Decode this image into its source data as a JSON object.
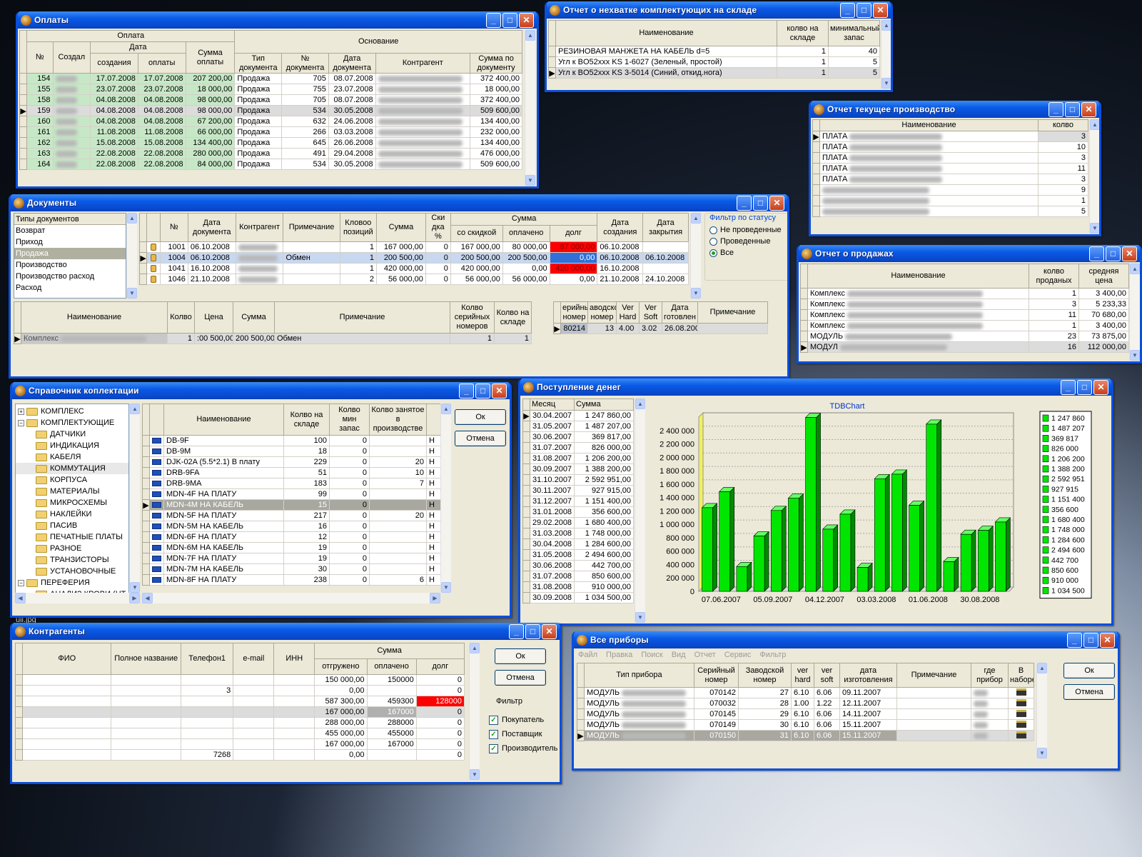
{
  "payments": {
    "title": "Оплаты",
    "grp_payment": "Оплата",
    "grp_basis": "Основание",
    "grp_date": "Дата",
    "cols": {
      "num": "№",
      "creator": "Создал",
      "created": "создания",
      "paid": "оплаты",
      "sum": "Сумма оплаты",
      "doctype": "Тип документа",
      "docnum": "№ документа",
      "docdate": "Дата документа",
      "contractor": "Контрагент",
      "docsum": "Сумма по документу"
    },
    "rows": [
      [
        "154",
        "17.07.2008",
        "17.07.2008",
        "207 200,00",
        "Продажа",
        "705",
        "08.07.2008",
        "372 400,00"
      ],
      [
        "155",
        "23.07.2008",
        "23.07.2008",
        "18 000,00",
        "Продажа",
        "755",
        "23.07.2008",
        "18 000,00"
      ],
      [
        "158",
        "04.08.2008",
        "04.08.2008",
        "98 000,00",
        "Продажа",
        "705",
        "08.07.2008",
        "372 400,00"
      ],
      [
        "159",
        "04.08.2008",
        "04.08.2008",
        "98 000,00",
        "Продажа",
        "534",
        "30.05.2008",
        "509 600,00"
      ],
      [
        "160",
        "04.08.2008",
        "04.08.2008",
        "67 200,00",
        "Продажа",
        "632",
        "24.06.2008",
        "134 400,00"
      ],
      [
        "161",
        "11.08.2008",
        "11.08.2008",
        "66 000,00",
        "Продажа",
        "266",
        "03.03.2008",
        "232 000,00"
      ],
      [
        "162",
        "15.08.2008",
        "15.08.2008",
        "134 400,00",
        "Продажа",
        "645",
        "26.06.2008",
        "134 400,00"
      ],
      [
        "163",
        "22.08.2008",
        "22.08.2008",
        "280 000,00",
        "Продажа",
        "491",
        "29.04.2008",
        "476 000,00"
      ],
      [
        "164",
        "22.08.2008",
        "22.08.2008",
        "84 000,00",
        "Продажа",
        "534",
        "30.05.2008",
        "509 600,00"
      ]
    ]
  },
  "shortage": {
    "title": "Отчет о нехватке комплектующих на складе",
    "cols": {
      "name": "Наименование",
      "qty": "колво на складе",
      "min": "минимальный запас"
    },
    "rows": [
      [
        "РЕЗИНОВАЯ МАНЖЕТА НА КАБЕЛЬ d=5",
        "1",
        "40"
      ],
      [
        "Угл к BO52xxx KS 1-6027 (Зеленый, простой)",
        "1",
        "5"
      ],
      [
        "Угл к BO52xxx KS 3-5014 (Синий, откид.нога)",
        "1",
        "5"
      ]
    ]
  },
  "production": {
    "title": "Отчет текущее производство",
    "cols": {
      "name": "Наименование",
      "qty": "колво"
    },
    "rows": [
      [
        "ПЛАТА",
        "3"
      ],
      [
        "ПЛАТА",
        "10"
      ],
      [
        "ПЛАТА",
        "3"
      ],
      [
        "ПЛАТА",
        "11"
      ],
      [
        "ПЛАТА",
        "3"
      ],
      [
        "",
        "9"
      ],
      [
        "",
        "1"
      ],
      [
        "",
        "5"
      ]
    ]
  },
  "sales": {
    "title": "Отчет о продажах",
    "cols": {
      "name": "Наименование",
      "sold": "колво проданых",
      "avg": "средняя цена"
    },
    "rows": [
      [
        "Комплекс",
        "1",
        "3 400,00"
      ],
      [
        "Комплекс",
        "3",
        "5 233,33"
      ],
      [
        "Комплекс",
        "11",
        "70 680,00"
      ],
      [
        "Комплекс",
        "1",
        "3 400,00"
      ],
      [
        "МОДУЛЬ",
        "23",
        "73 875,00"
      ],
      [
        "МОДУЛ",
        "16",
        "112 000,00"
      ]
    ]
  },
  "documents": {
    "title": "Документы",
    "types": [
      "Типы документов",
      "Возврат",
      "Приход",
      "Продажа",
      "Производство",
      "Производство расход",
      "Расход"
    ],
    "cols": {
      "num": "№",
      "date": "Дата документа",
      "contractor": "Контрагент",
      "note": "Примечание",
      "positions": "Кловоо позиций",
      "sum": "Сумма",
      "discount": "Ски дка %",
      "grp_sum": "Сумма",
      "withdisc": "со скидкой",
      "paid": "оплачено",
      "debt": "долг",
      "created": "Дата создания",
      "closed": "Дата закрытия"
    },
    "rows": [
      [
        "1001",
        "06.10.2008",
        "",
        "1",
        "167 000,00",
        "0",
        "167 000,00",
        "80 000,00",
        "87 000,00",
        "06.10.2008",
        ""
      ],
      [
        "1004",
        "06.10.2008",
        "Обмен",
        "1",
        "200 500,00",
        "0",
        "200 500,00",
        "200 500,00",
        "0,00",
        "06.10.2008",
        "06.10.2008"
      ],
      [
        "1041",
        "16.10.2008",
        "",
        "1",
        "420 000,00",
        "0",
        "420 000,00",
        "0,00",
        "420 000,00",
        "16.10.2008",
        ""
      ],
      [
        "1046",
        "21.10.2008",
        "",
        "2",
        "56 000,00",
        "0",
        "56 000,00",
        "56 000,00",
        "0,00",
        "21.10.2008",
        "24.10.2008"
      ]
    ],
    "filter": {
      "legend": "Фильтр по статусу",
      "opt1": "Не проведенные",
      "opt2": "Проведенные",
      "opt3": "Все"
    },
    "items_cols": {
      "name": "Наименование",
      "qty": "Колво",
      "price": "Цена",
      "sum": "Сумма",
      "note": "Примечание",
      "serials": "Колво серийных номеров",
      "stock": "Колво на складе"
    },
    "items_row": [
      "Комплекс",
      "1",
      ":00 500,00",
      "200 500,00",
      "Обмен",
      "1",
      "1"
    ],
    "ser_cols": {
      "serial": "ерийны номер",
      "factory": "аводско номер",
      "hard": "Ver Hard",
      "soft": "Ver Soft",
      "made": "Дата готовлен",
      "note": "Примечание"
    },
    "ser_row": [
      "80214",
      "13",
      "4.00",
      "3.02",
      "26.08.200",
      ""
    ]
  },
  "catalog": {
    "title": "Справочник коплектации",
    "tree": [
      {
        "t": "КОМПЛЕКС",
        "lvl": 0,
        "tog": "+"
      },
      {
        "t": "КОМПЛЕКТУЮЩИЕ",
        "lvl": 0,
        "tog": "−"
      },
      {
        "t": "ДАТЧИКИ",
        "lvl": 1
      },
      {
        "t": "ИНДИКАЦИЯ",
        "lvl": 1
      },
      {
        "t": "КАБЕЛЯ",
        "lvl": 1
      },
      {
        "t": "КОММУТАЦИЯ",
        "lvl": 1
      },
      {
        "t": "КОРПУСА",
        "lvl": 1
      },
      {
        "t": "МАТЕРИАЛЫ",
        "lvl": 1
      },
      {
        "t": "МИКРОСХЕМЫ",
        "lvl": 1
      },
      {
        "t": "НАКЛЕЙКИ",
        "lvl": 1
      },
      {
        "t": "ПАСИВ",
        "lvl": 1
      },
      {
        "t": "ПЕЧАТНЫЕ ПЛАТЫ",
        "lvl": 1
      },
      {
        "t": "РАЗНОЕ",
        "lvl": 1
      },
      {
        "t": "ТРАНЗИСТОРЫ",
        "lvl": 1
      },
      {
        "t": "УСТАНОВОЧНЫЕ",
        "lvl": 1
      },
      {
        "t": "ПЕРЕФЕРИЯ",
        "lvl": 0,
        "tog": "−"
      },
      {
        "t": "АНАЛИЗ КРОВИ (НТ",
        "lvl": 1
      }
    ],
    "cols": {
      "name": "Наименование",
      "stock": "Колво на складе",
      "min": "Колво мин запас",
      "busy": "Колво занятое в производстве"
    },
    "rows": [
      [
        "DB-9F",
        "100",
        "0",
        "",
        "Н"
      ],
      [
        "DB-9M",
        "18",
        "0",
        "",
        "Н"
      ],
      [
        "DJK-02A (5.5*2.1) В плату",
        "229",
        "0",
        "20",
        "Н"
      ],
      [
        "DRB-9FA",
        "51",
        "0",
        "10",
        "Н"
      ],
      [
        "DRB-9MA",
        "183",
        "0",
        "7",
        "Н"
      ],
      [
        "MDN-4F НА ПЛАТУ",
        "99",
        "0",
        "",
        "Н"
      ],
      [
        "MDN-4M НА КАБЕЛЬ",
        "15",
        "0",
        "",
        "Н"
      ],
      [
        "MDN-5F НА ПЛАТУ",
        "217",
        "0",
        "20",
        "Н"
      ],
      [
        "MDN-5M НА КАБЕЛЬ",
        "16",
        "0",
        "",
        "Н"
      ],
      [
        "MDN-6F НА ПЛАТУ",
        "12",
        "0",
        "",
        "Н"
      ],
      [
        "MDN-6M НА КАБЕЛЬ",
        "19",
        "0",
        "",
        "Н"
      ],
      [
        "MDN-7F НА ПЛАТУ",
        "19",
        "0",
        "",
        "Н"
      ],
      [
        "MDN-7M НА КАБЕЛЬ",
        "30",
        "0",
        "",
        "Н"
      ],
      [
        "MDN-8F НА ПЛАТУ",
        "238",
        "0",
        "6",
        "Н"
      ]
    ],
    "ok": "Ок",
    "cancel": "Отмена"
  },
  "money": {
    "title": "Поступление денег",
    "cols": {
      "month": "Месяц",
      "sum": "Сумма"
    },
    "rows": [
      [
        "30.04.2007",
        "1 247 860,00"
      ],
      [
        "31.05.2007",
        "1 487 207,00"
      ],
      [
        "30.06.2007",
        "369 817,00"
      ],
      [
        "31.07.2007",
        "826 000,00"
      ],
      [
        "31.08.2007",
        "1 206 200,00"
      ],
      [
        "30.09.2007",
        "1 388 200,00"
      ],
      [
        "31.10.2007",
        "2 592 951,00"
      ],
      [
        "30.11.2007",
        "927 915,00"
      ],
      [
        "31.12.2007",
        "1 151 400,00"
      ],
      [
        "31.01.2008",
        "356 600,00"
      ],
      [
        "29.02.2008",
        "1 680 400,00"
      ],
      [
        "31.03.2008",
        "1 748 000,00"
      ],
      [
        "30.04.2008",
        "1 284 600,00"
      ],
      [
        "31.05.2008",
        "2 494 600,00"
      ],
      [
        "30.06.2008",
        "442 700,00"
      ],
      [
        "31.07.2008",
        "850 600,00"
      ],
      [
        "31.08.2008",
        "910 000,00"
      ],
      [
        "30.09.2008",
        "1 034 500,00"
      ]
    ]
  },
  "chart_data": {
    "type": "bar",
    "title": "TDBChart",
    "categories": [
      "30.04.2007",
      "31.05.2007",
      "30.06.2007",
      "31.07.2007",
      "31.08.2007",
      "30.09.2007",
      "31.10.2007",
      "30.11.2007",
      "31.12.2007",
      "31.01.2008",
      "29.02.2008",
      "31.03.2008",
      "30.04.2008",
      "31.05.2008",
      "30.06.2008",
      "31.07.2008",
      "31.08.2008",
      "30.09.2008"
    ],
    "values": [
      1247860,
      1487207,
      369817,
      826000,
      1206200,
      1388200,
      2592951,
      927915,
      1151400,
      356600,
      1680400,
      1748000,
      1284600,
      2494600,
      442700,
      850600,
      910000,
      1034500
    ],
    "xtick_labels": [
      "07.06.2007",
      "05.09.2007",
      "04.12.2007",
      "03.03.2008",
      "01.06.2008",
      "30.08.2008"
    ],
    "ytick_labels": [
      "0",
      "200 000",
      "400 000",
      "600 000",
      "800 000",
      "1 000 000",
      "1 200 000",
      "1 400 000",
      "1 600 000",
      "1 800 000",
      "2 000 000",
      "2 200 000",
      "2 400 000"
    ],
    "legend": [
      "1 247 860",
      "1 487 207",
      "369 817",
      "826 000",
      "1 206 200",
      "1 388 200",
      "2 592 951",
      "927 915",
      "1 151 400",
      "356 600",
      "1 680 400",
      "1 748 000",
      "1 284 600",
      "2 494 600",
      "442 700",
      "850 600",
      "910 000",
      "1 034 500"
    ],
    "ylim": [
      0,
      2600000
    ],
    "legend_position": "right",
    "grid": true,
    "bar_color": "#00e600"
  },
  "contractors": {
    "title": "Контрагенты",
    "cols": {
      "fio": "ФИО",
      "full": "Полное название",
      "phone": "Телефон1",
      "email": "e-mail",
      "inn": "ИНН",
      "grp_sum": "Сумма",
      "shipped": "отгружено",
      "paid": "оплачено",
      "debt": "долг"
    },
    "rows": [
      [
        "",
        "",
        "150 000,00",
        "150000",
        "0"
      ],
      [
        "",
        "3",
        "0,00",
        "",
        "0"
      ],
      [
        "",
        "",
        "587 300,00",
        "459300",
        "128000"
      ],
      [
        "",
        "",
        "167 000,00",
        "167000",
        "0"
      ],
      [
        "",
        "",
        "288 000,00",
        "288000",
        "0"
      ],
      [
        "",
        "",
        "455 000,00",
        "455000",
        "0"
      ],
      [
        "",
        "",
        "167 000,00",
        "167000",
        "0"
      ],
      [
        "",
        "7268",
        "0,00",
        "",
        "0"
      ]
    ],
    "ok": "Ок",
    "cancel": "Отмена",
    "filter": "Фильтр",
    "buyer": "Покупатель",
    "supplier": "Поставщик",
    "producer": "Производитель"
  },
  "devices": {
    "title": "Все приборы",
    "menu": [
      "Файл",
      "Правка",
      "Поиск",
      "Вид",
      "Отчет",
      "Сервис",
      "Фильтр"
    ],
    "cols": {
      "type": "Тип прибора",
      "serial": "Серийный номер",
      "factory": "Заводской номер",
      "hard": "ver hard",
      "soft": "ver soft",
      "made": "дата изготовления",
      "note": "Примечание",
      "where": "где прибор",
      "set": "В наборе"
    },
    "rows": [
      [
        "МОДУЛЬ",
        "070142",
        "27",
        "6.10",
        "6.06",
        "09.11.2007"
      ],
      [
        "МОДУЛЬ",
        "070032",
        "28",
        "1.00",
        "1.22",
        "12.11.2007"
      ],
      [
        "МОДУЛЬ",
        "070145",
        "29",
        "6.10",
        "6.06",
        "14.11.2007"
      ],
      [
        "МОДУЛЬ",
        "070149",
        "30",
        "6.10",
        "6.06",
        "15.11.2007"
      ],
      [
        "МОДУЛЬ",
        "070150",
        "31",
        "6.10",
        "6.06",
        "15.11.2007"
      ]
    ],
    "ok": "Ок",
    "cancel": "Отмена"
  },
  "desktop": {
    "file_label": "ull.jpg"
  }
}
